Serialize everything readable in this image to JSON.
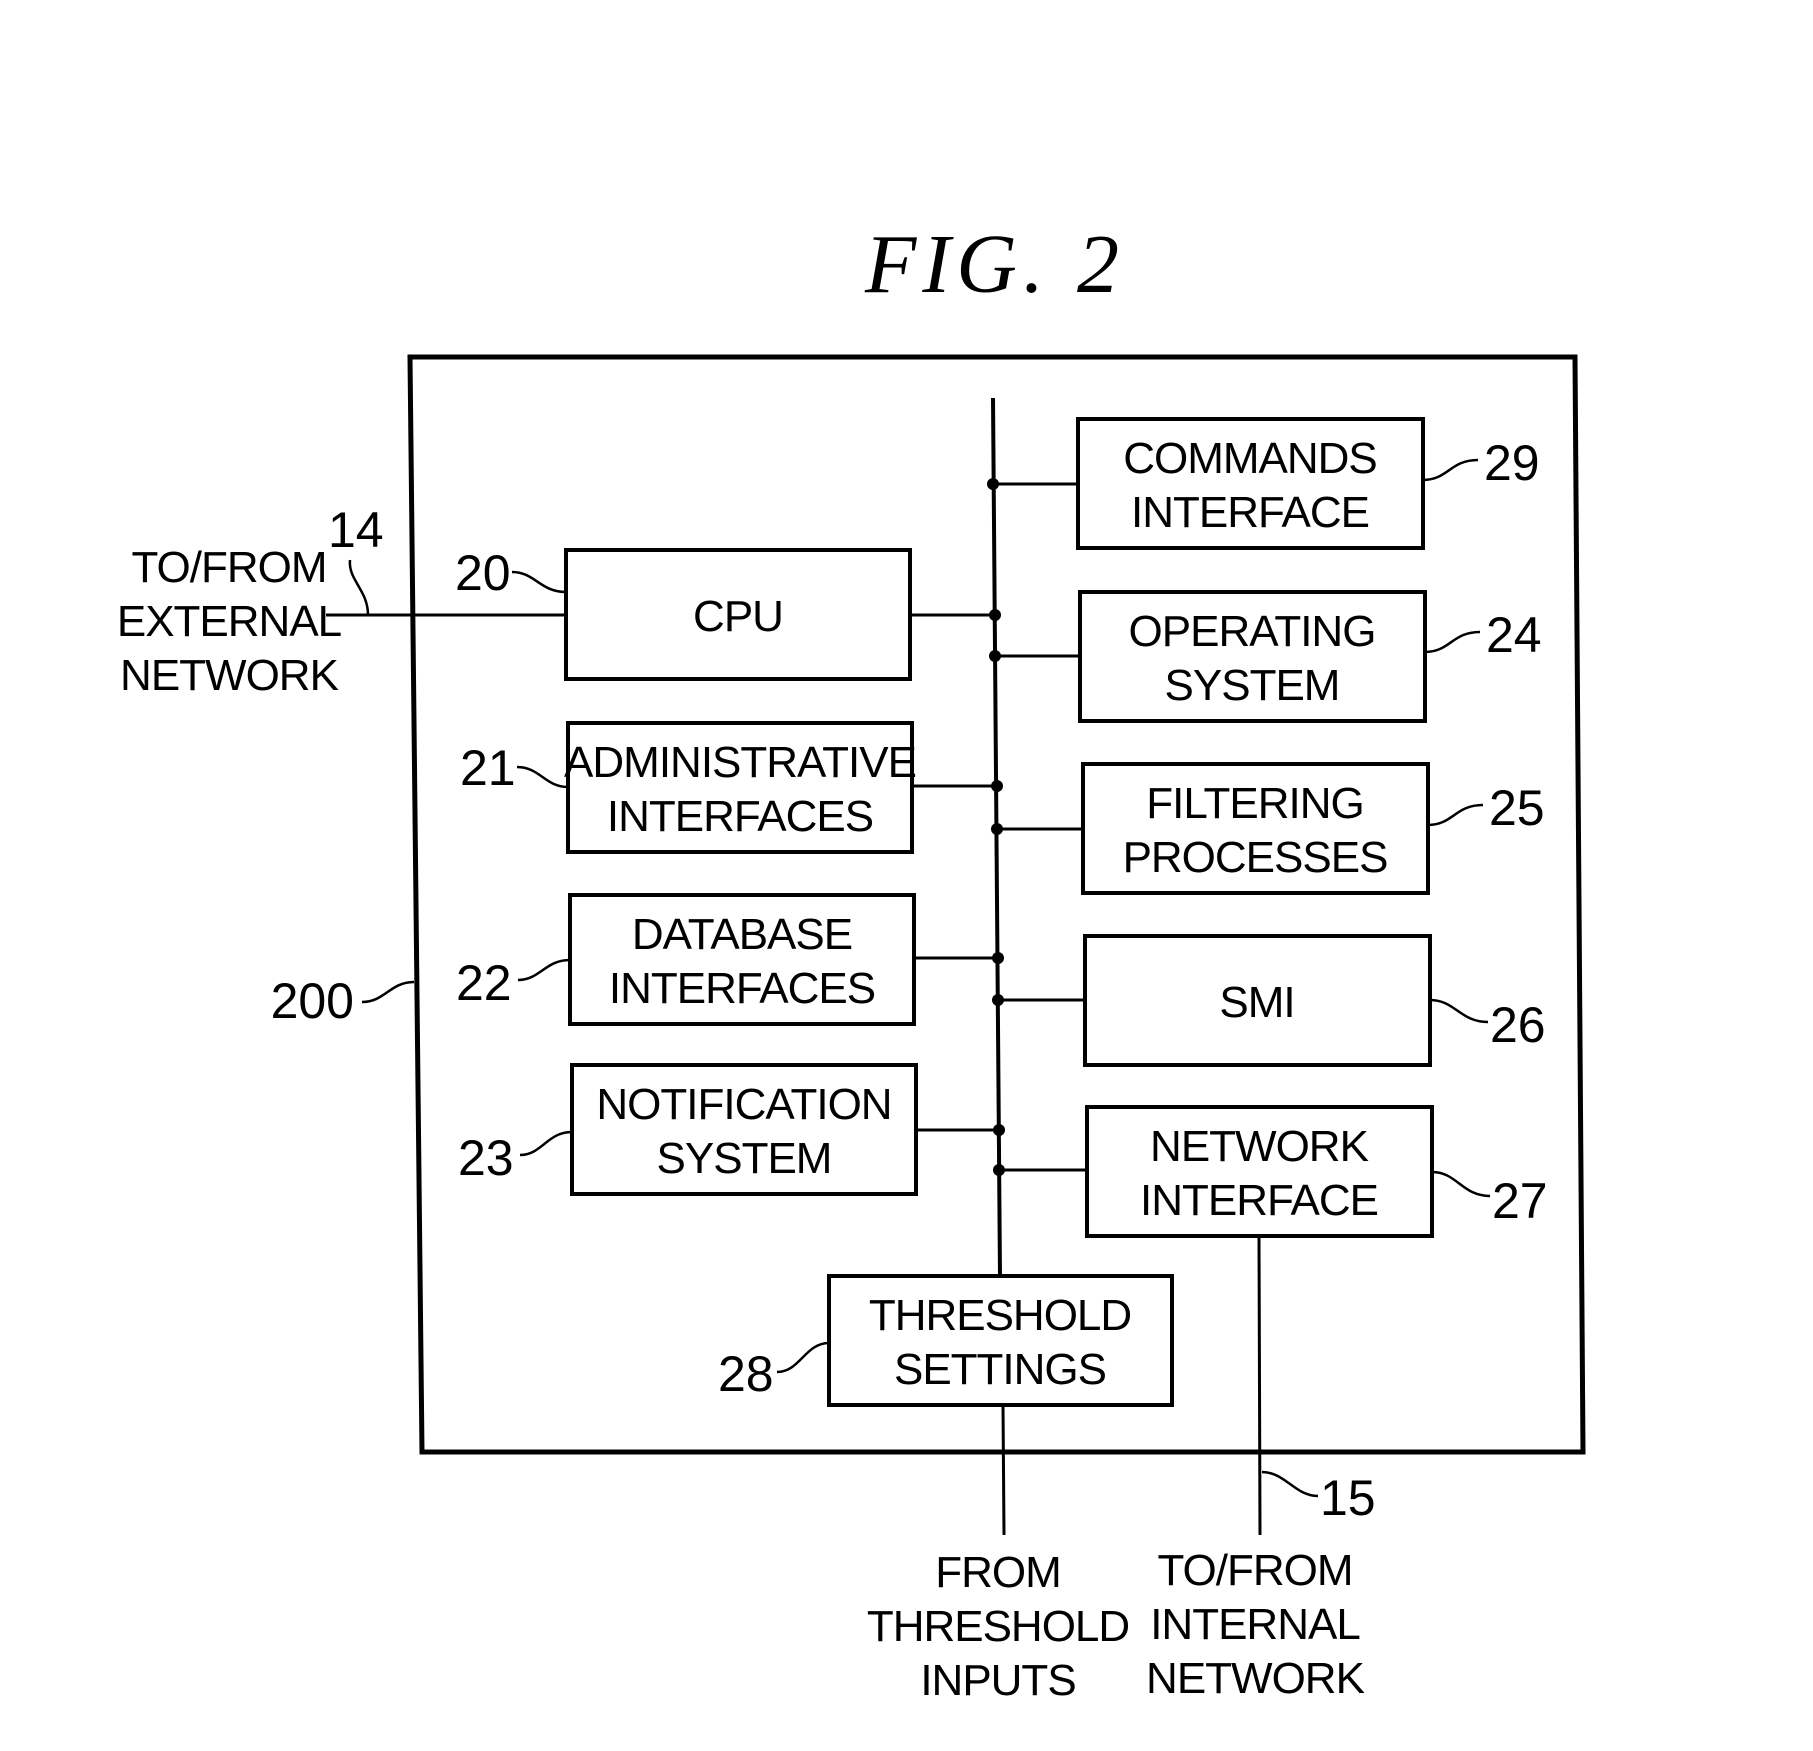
{
  "figure": {
    "title": "FIG. 2",
    "system_ref": "200",
    "components": [
      {
        "id": "cpu",
        "ref": "20",
        "lines": [
          "CPU"
        ]
      },
      {
        "id": "admin",
        "ref": "21",
        "lines": [
          "ADMINISTRATIVE",
          "INTERFACES"
        ]
      },
      {
        "id": "database",
        "ref": "22",
        "lines": [
          "DATABASE",
          "INTERFACES"
        ]
      },
      {
        "id": "notification",
        "ref": "23",
        "lines": [
          "NOTIFICATION",
          "SYSTEM"
        ]
      },
      {
        "id": "commands",
        "ref": "29",
        "lines": [
          "COMMANDS",
          "INTERFACE"
        ]
      },
      {
        "id": "os",
        "ref": "24",
        "lines": [
          "OPERATING",
          "SYSTEM"
        ]
      },
      {
        "id": "filtering",
        "ref": "25",
        "lines": [
          "FILTERING",
          "PROCESSES"
        ]
      },
      {
        "id": "smi",
        "ref": "26",
        "lines": [
          "SMI"
        ]
      },
      {
        "id": "netif",
        "ref": "27",
        "lines": [
          "NETWORK",
          "INTERFACE"
        ]
      },
      {
        "id": "threshold",
        "ref": "28",
        "lines": [
          "THRESHOLD",
          "SETTINGS"
        ]
      }
    ],
    "external_links": {
      "external_network": {
        "ref": "14",
        "lines": [
          "TO/FROM",
          "EXTERNAL",
          "NETWORK"
        ]
      },
      "threshold_inputs": {
        "lines": [
          "FROM",
          "THRESHOLD",
          "INPUTS"
        ]
      },
      "internal_network": {
        "ref": "15",
        "lines": [
          "TO/FROM",
          "INTERNAL",
          "NETWORK"
        ]
      }
    }
  }
}
